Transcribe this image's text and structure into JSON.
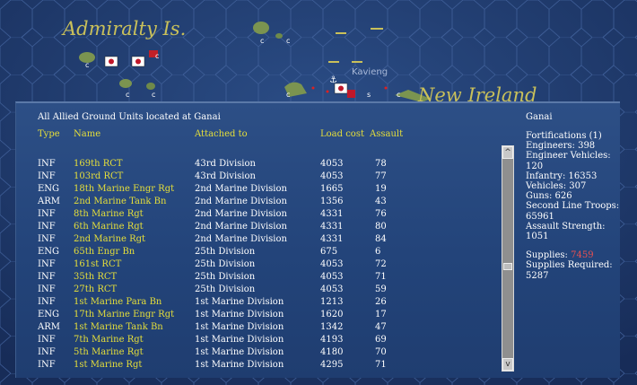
{
  "map": {
    "labels": {
      "admiralty": "Admiralty Is.",
      "new_ireland": "New Ireland",
      "kavieng": "Kavieng"
    },
    "hex_glyphs": [
      "c",
      "c",
      "c",
      "c",
      "c",
      "c",
      "c",
      "c",
      "s"
    ],
    "colors": {
      "sea": "#1f3a6e",
      "hex_line": "#3e5a8f",
      "land": "#6f8a4a",
      "label": "#c9c05a"
    }
  },
  "panel": {
    "title": "All Allied Ground Units located at Ganai",
    "columns": {
      "type": "Type",
      "name": "Name",
      "attached": "Attached to",
      "load": "Load cost",
      "assault": "Assault"
    },
    "units": [
      {
        "type": "INF",
        "name": "169th RCT",
        "attached": "43rd Division",
        "load": "4053",
        "assault": "78"
      },
      {
        "type": "INF",
        "name": "103rd RCT",
        "attached": "43rd Division",
        "load": "4053",
        "assault": "77"
      },
      {
        "type": "ENG",
        "name": "18th Marine Engr Rgt",
        "attached": "2nd Marine Division",
        "load": "1665",
        "assault": "19"
      },
      {
        "type": "ARM",
        "name": "2nd Marine Tank Bn",
        "attached": "2nd Marine Division",
        "load": "1356",
        "assault": "43"
      },
      {
        "type": "INF",
        "name": "8th Marine Rgt",
        "attached": "2nd Marine Division",
        "load": "4331",
        "assault": "76"
      },
      {
        "type": "INF",
        "name": "6th Marine Rgt",
        "attached": "2nd Marine Division",
        "load": "4331",
        "assault": "80"
      },
      {
        "type": "INF",
        "name": "2nd Marine Rgt",
        "attached": "2nd Marine Division",
        "load": "4331",
        "assault": "84"
      },
      {
        "type": "ENG",
        "name": "65th Engr Bn",
        "attached": "25th Division",
        "load": "675",
        "assault": "6"
      },
      {
        "type": "INF",
        "name": "161st RCT",
        "attached": "25th Division",
        "load": "4053",
        "assault": "72"
      },
      {
        "type": "INF",
        "name": "35th RCT",
        "attached": "25th Division",
        "load": "4053",
        "assault": "71"
      },
      {
        "type": "INF",
        "name": "27th RCT",
        "attached": "25th Division",
        "load": "4053",
        "assault": "59"
      },
      {
        "type": "INF",
        "name": "1st Marine Para Bn",
        "attached": "1st Marine Division",
        "load": "1213",
        "assault": "26"
      },
      {
        "type": "ENG",
        "name": "17th Marine Engr Rgt",
        "attached": "1st Marine Division",
        "load": "1620",
        "assault": "17"
      },
      {
        "type": "ARM",
        "name": "1st Marine Tank Bn",
        "attached": "1st Marine Division",
        "load": "1342",
        "assault": "47"
      },
      {
        "type": "INF",
        "name": "7th Marine Rgt",
        "attached": "1st Marine Division",
        "load": "4193",
        "assault": "69"
      },
      {
        "type": "INF",
        "name": "5th Marine Rgt",
        "attached": "1st Marine Division",
        "load": "4180",
        "assault": "70"
      },
      {
        "type": "INF",
        "name": "1st Marine Rgt",
        "attached": "1st Marine Division",
        "load": "4295",
        "assault": "71"
      }
    ],
    "scroll_up": "^",
    "scroll_down": "v"
  },
  "summary": {
    "location": "Ganai",
    "fortifications": "Fortifications (1)",
    "engineers": "Engineers: 398",
    "engineer_vehicles": "Engineer Vehicles: 120",
    "infantry": "Infantry: 16353",
    "vehicles": "Vehicles: 307",
    "guns": "Guns: 626",
    "second_line": "Second Line Troops: 65961",
    "assault_strength": "Assault Strength: 1051",
    "supplies_label": "Supplies:",
    "supplies_value": "7459",
    "supplies_required": "Supplies Required: 5287"
  }
}
